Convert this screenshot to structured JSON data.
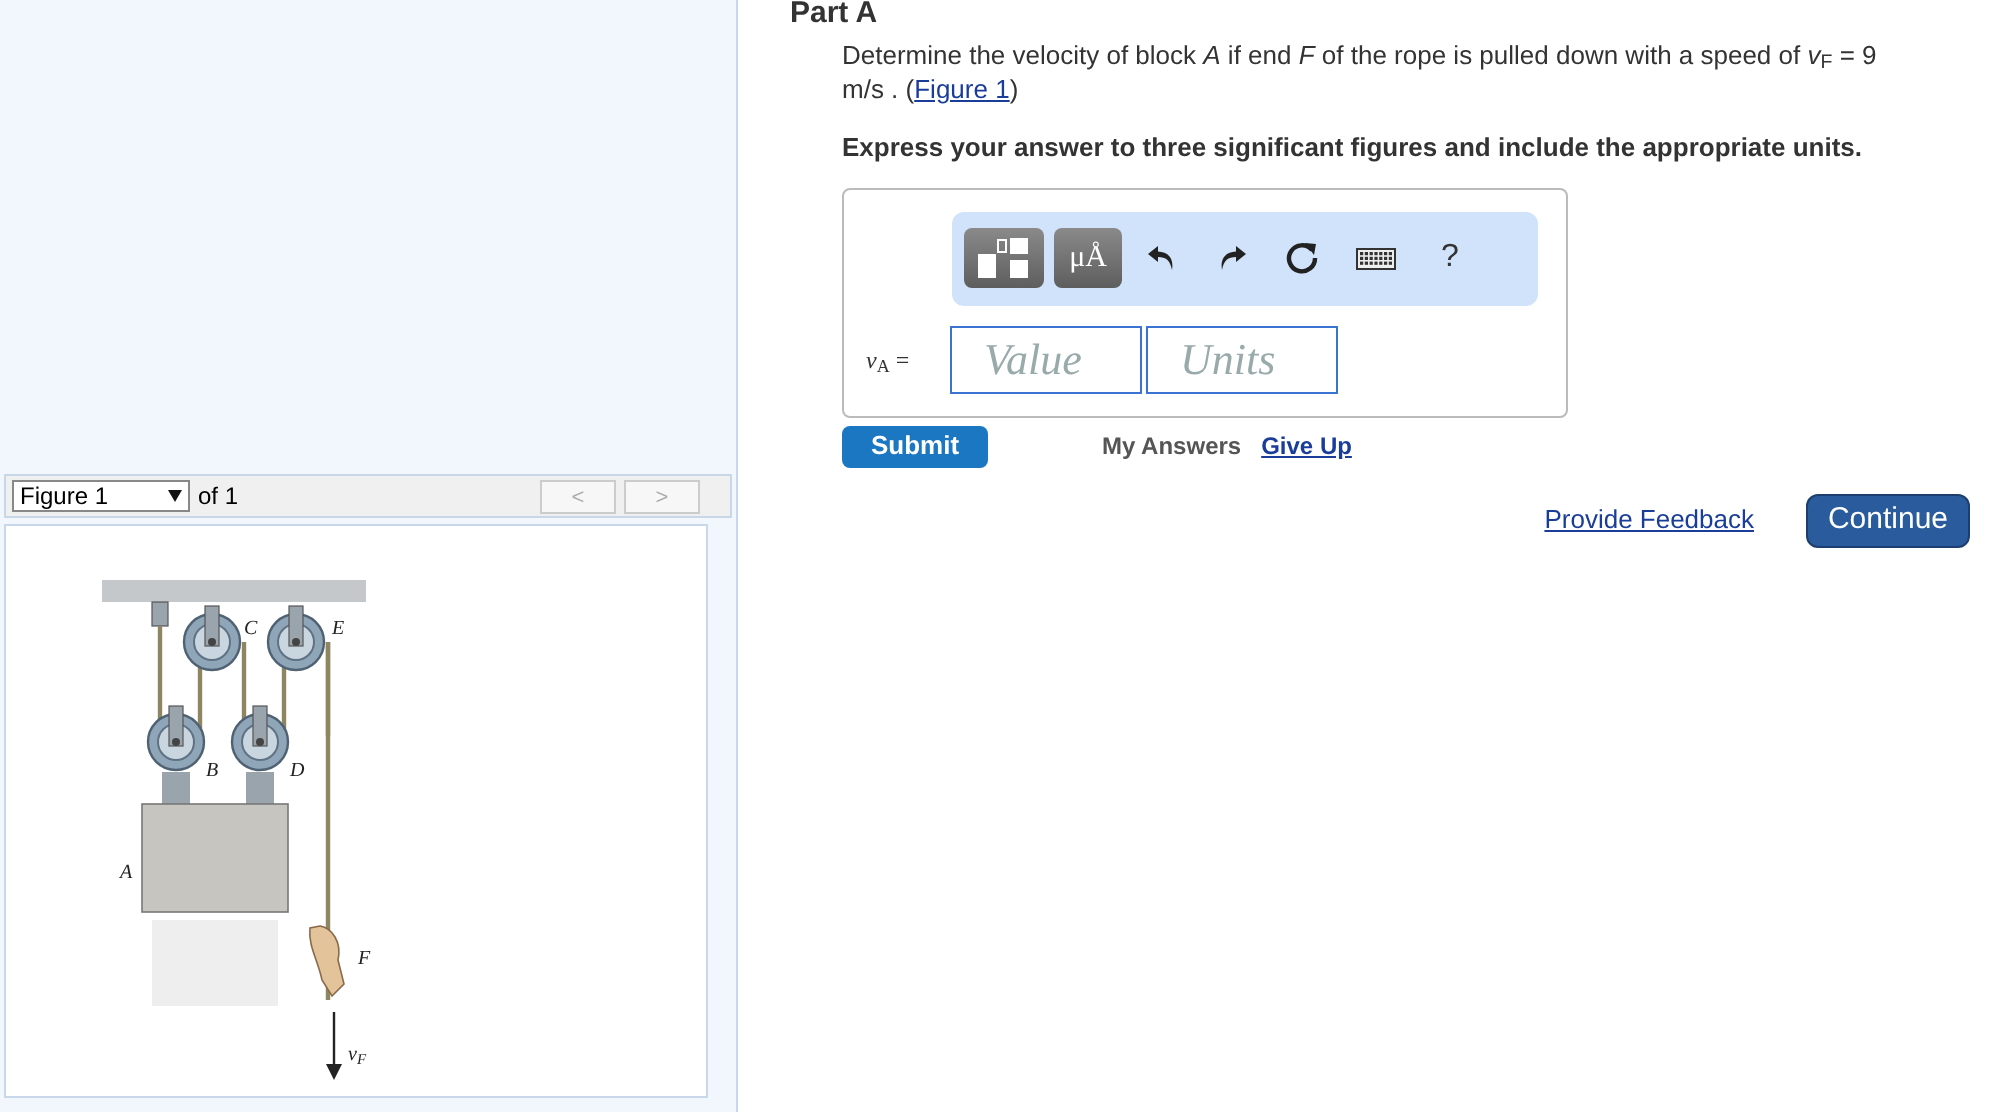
{
  "part_title": "Part A",
  "problem": {
    "text_before": "Determine the velocity of block *A* if end *F* of the rope is pulled down with a speed of *v*$_{F}$ = 9 m/s . (",
    "link": "Figure 1",
    "text_after": ")"
  },
  "instruction": "Express your answer to three significant figures and include the appropriate units.",
  "toolbar": [
    {
      "kind": "templates"
    },
    {
      "kind": "symbols",
      "label": "μÅ"
    },
    {
      "kind": "undo"
    },
    {
      "kind": "redo"
    },
    {
      "kind": "reset"
    },
    {
      "kind": "keyboard"
    },
    {
      "kind": "help",
      "label": "?"
    }
  ],
  "answer": {
    "label": "*v*$_{A}$ =",
    "value_placeholder": "Value",
    "units_placeholder": "Units"
  },
  "submit": "Submit",
  "my_answers": "My Answers",
  "give_up": "Give Up",
  "feedback_link": "Provide Feedback",
  "continue": "Continue",
  "figure_nav": {
    "select": "Figure 1",
    "of": "of 1",
    "prev": "<",
    "next": ">",
    "prev_disabled": true,
    "next_disabled": true
  },
  "figure_labels": [
    "C",
    "E",
    "B",
    "D",
    "A",
    "F",
    "*v*$_{F}$"
  ]
}
